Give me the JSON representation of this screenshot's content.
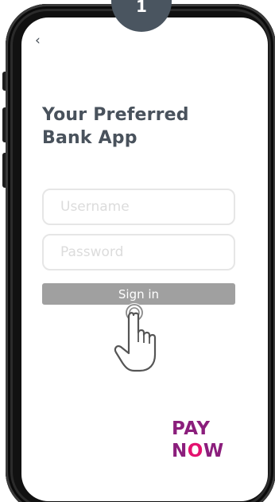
{
  "step": {
    "number": "1"
  },
  "nav": {
    "back_symbol": "‹"
  },
  "header": {
    "title_line1": "Your Preferred",
    "title_line2": "Bank App"
  },
  "form": {
    "username": {
      "placeholder": "Username",
      "value": ""
    },
    "password": {
      "placeholder": "Password",
      "value": ""
    },
    "signin_label": "Sign in"
  },
  "brand": {
    "line1": "PAY",
    "line2_prefix": "N",
    "line2_o": "O",
    "line2_suffix": "W"
  },
  "colors": {
    "title": "#49525c",
    "badge": "#4a5560",
    "signin_button": "#a0a0a0",
    "brand_purple": "#8b1e7c",
    "brand_pink": "#e3126f"
  },
  "icons": {
    "cursor": "pointing-hand-icon",
    "back": "chevron-left-icon"
  }
}
